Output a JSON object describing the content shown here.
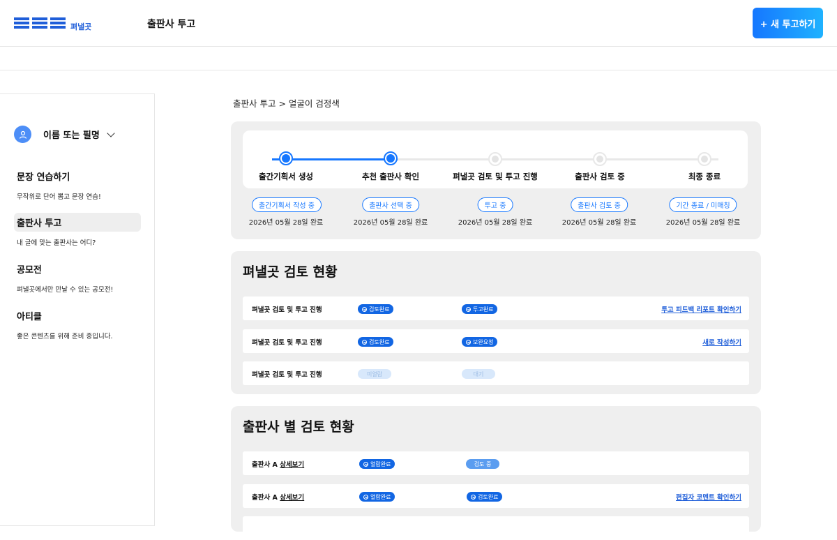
{
  "header": {
    "logo_text": "펴낼곳",
    "title": "출판사 투고",
    "new_button": "+ 새 투고하기"
  },
  "sidebar": {
    "user_name": "이름 또는 필명",
    "items": [
      {
        "label": "문장 연습하기",
        "desc": "무작위로 단어 뽑고 문장 연습!"
      },
      {
        "label": "출판사 투고",
        "desc": "내 글에 맞는 출판사는 어디?"
      },
      {
        "label": "공모전",
        "desc": "펴낼곳에서만 만날 수 있는 공모전!"
      },
      {
        "label": "아티클",
        "desc": "좋은 콘텐츠를 위해 준비 중입니다."
      }
    ]
  },
  "breadcrumb": "출판사 투고 > 얼굴이 검정색",
  "steps": [
    {
      "label": "출간기획서 생성",
      "badge": "출간기획서 작성 중",
      "date": "2026년 05월 28일 완료",
      "done": true
    },
    {
      "label": "추천 출판사 확인",
      "badge": "출판사 선택 중",
      "date": "2026년 05월 28일 완료",
      "done": true
    },
    {
      "label": "펴낼곳 검토 및 투고 진행",
      "badge": "투고 중",
      "date": "2026년 05월 28일 완료",
      "done": false
    },
    {
      "label": "출판사 검토 중",
      "badge": "출판사 검토 중",
      "date": "2026년 05월 28일 완료",
      "done": false
    },
    {
      "label": "최종 종료",
      "badge": "기간 종료 / 미매칭",
      "date": "2026년 05월 28일 완료",
      "done": false
    }
  ],
  "review_status": {
    "title": "펴낼곳 검토 현황",
    "rows": [
      {
        "name": "펴낼곳 검토 및 투고 진행",
        "status1": "검토완료",
        "status2": "투고완료",
        "link": "투고 피드백 리포트 확인하기"
      },
      {
        "name": "펴낼곳 검토 및 투고 진행",
        "status1": "검토완료",
        "status2": "보완요청",
        "link": "새로 작성하기"
      },
      {
        "name": "펴낼곳 검토 및 투고 진행",
        "status1": "미열람",
        "status2": "대기",
        "link": ""
      }
    ]
  },
  "publisher_status": {
    "title": "출판사 별 검토 현황",
    "rows": [
      {
        "name": "출판사 A",
        "detail": "상세보기",
        "status1": "열람완료",
        "status2": "검토 중",
        "link": ""
      },
      {
        "name": "출판사 A",
        "detail": "상세보기",
        "status1": "열람완료",
        "status2": "검토완료",
        "link": "편집자 코멘트 확인하기"
      }
    ]
  },
  "colors": {
    "accent": "#1677ff",
    "panel": "#efefef"
  }
}
